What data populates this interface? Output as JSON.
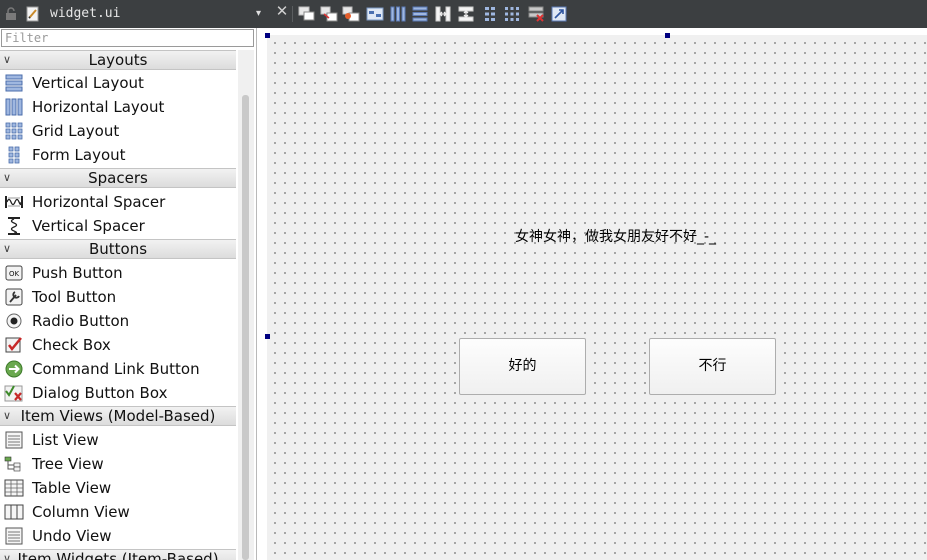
{
  "file_tab": {
    "name": "widget.ui",
    "dropdown_glyph": "▾",
    "close_glyph": "✕"
  },
  "toolbar": {
    "icons": [
      "edit-widgets-icon",
      "edit-signals-slots-icon",
      "edit-buddies-icon",
      "edit-tab-order-icon",
      "layout-horizontal-icon",
      "layout-vertical-icon",
      "layout-horizontal-splitter-icon",
      "layout-vertical-splitter-icon",
      "layout-form-icon",
      "layout-grid-icon",
      "break-layout-icon",
      "adjust-size-icon"
    ]
  },
  "widget_box": {
    "filter_placeholder": "Filter",
    "categories": [
      {
        "label": "Layouts",
        "items": [
          "Vertical Layout",
          "Horizontal Layout",
          "Grid Layout",
          "Form Layout"
        ]
      },
      {
        "label": "Spacers",
        "items": [
          "Horizontal Spacer",
          "Vertical Spacer"
        ]
      },
      {
        "label": "Buttons",
        "items": [
          "Push Button",
          "Tool Button",
          "Radio Button",
          "Check Box",
          "Command Link Button",
          "Dialog Button Box"
        ]
      },
      {
        "label": "Item Views (Model-Based)",
        "items": [
          "List View",
          "Tree View",
          "Table View",
          "Column View",
          "Undo View"
        ]
      },
      {
        "label": "Item Widgets (Item-Based)",
        "items": []
      }
    ]
  },
  "form": {
    "label_text": "女神女神，做我女朋友好不好_-_",
    "buttons": [
      {
        "label": "好的"
      },
      {
        "label": "不行"
      }
    ]
  },
  "colors": {
    "toolbar_bg": "#3c3f41",
    "canvas_bg": "#f0f0f0",
    "handle": "#000080"
  }
}
